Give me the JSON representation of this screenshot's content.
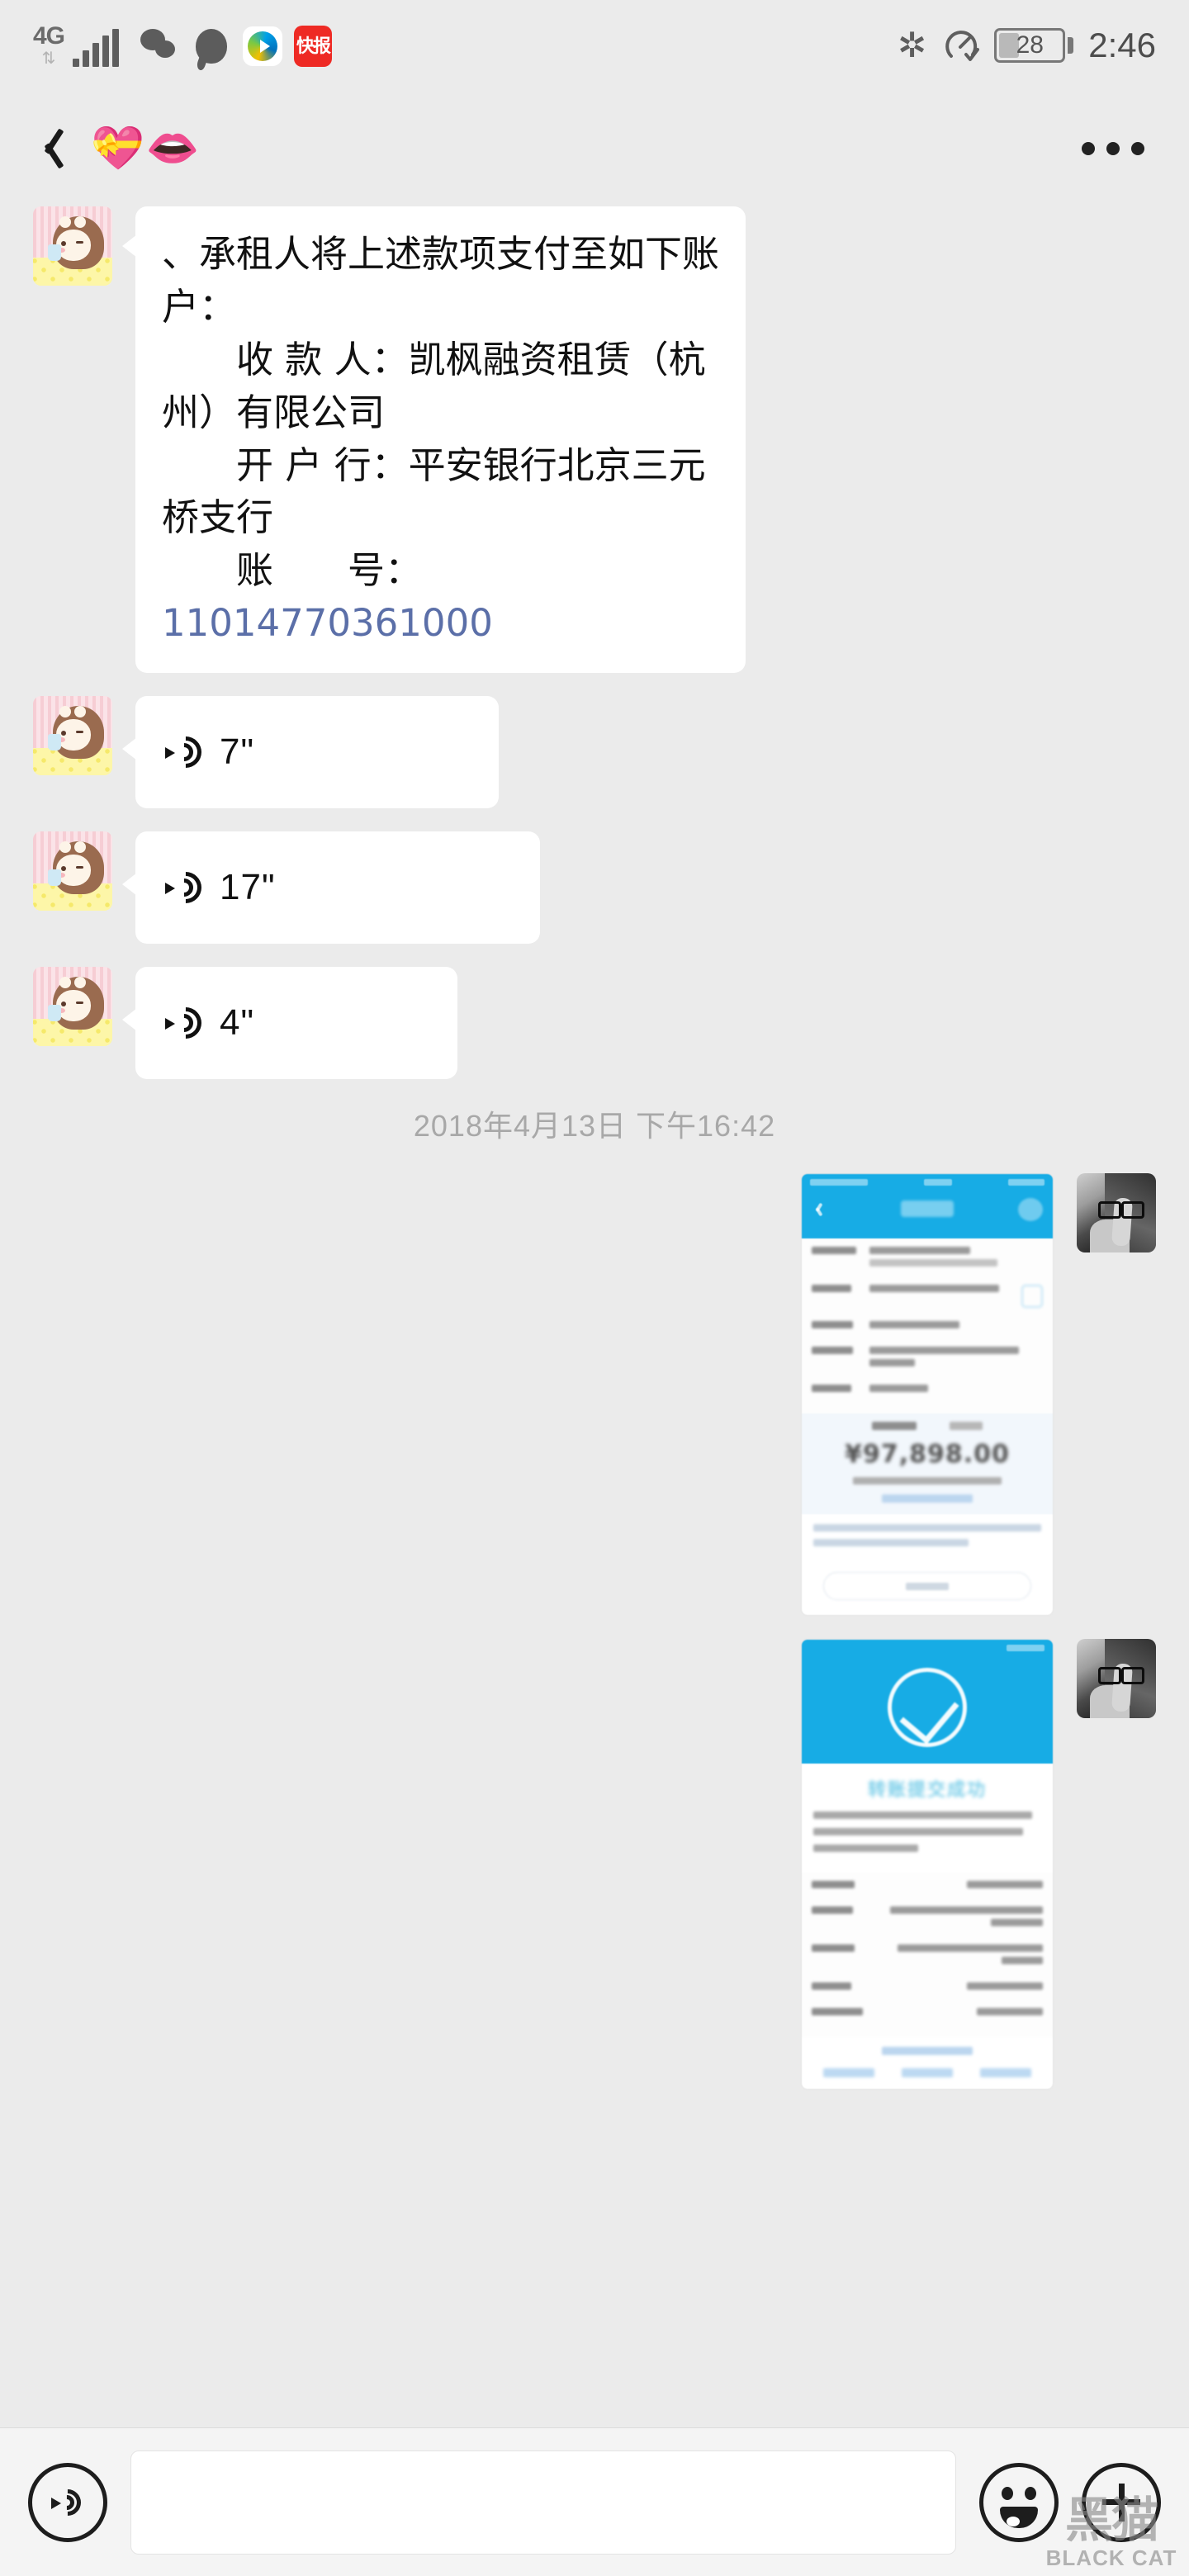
{
  "status_bar": {
    "network_type": "4G",
    "signal_icon": "signal-bars-icon",
    "app_icons": [
      "wechat-icon",
      "qq-icon",
      "tencent-video-icon",
      "kuaibao-icon"
    ],
    "kuaibao_label": "快报",
    "bluetooth_icon": "bluetooth-icon",
    "speed_icon": "speedometer-icon",
    "battery_percent": "28",
    "time": "2:46"
  },
  "navbar": {
    "back_icon": "back-chevron-icon",
    "title": "💝👄",
    "more_icon": "more-options-icon"
  },
  "messages": [
    {
      "type": "text",
      "side": "left",
      "avatar": "contact-avatar-cartoon-girl",
      "text_lines": [
        "、承租人将上述款项支付至如下账",
        "户：",
        "　　收 款 人：凯枫融资租赁（杭",
        "州）有限公司",
        "　　开 户 行：平安银行北京三元",
        "桥支行",
        "　　账　　号："
      ],
      "account_number": "11014770361000"
    },
    {
      "type": "voice",
      "side": "left",
      "avatar": "contact-avatar-cartoon-girl",
      "duration": "7\"",
      "icon": "voice-wave-icon"
    },
    {
      "type": "voice",
      "side": "left",
      "avatar": "contact-avatar-cartoon-girl",
      "duration": "17\"",
      "icon": "voice-wave-icon"
    },
    {
      "type": "voice",
      "side": "left",
      "avatar": "contact-avatar-cartoon-girl",
      "duration": "4\"",
      "icon": "voice-wave-icon"
    }
  ],
  "time_divider": "2018年4月13日 下午16:42",
  "image_messages": [
    {
      "side": "right",
      "avatar": "self-avatar-bw-photo",
      "kind": "bank-transfer-confirm-screenshot",
      "header_color": "#17ace5",
      "amount": "¥97,898.00"
    },
    {
      "side": "right",
      "avatar": "self-avatar-bw-photo",
      "kind": "transfer-success-screenshot",
      "header_color": "#17ace5",
      "success_title": "转账提交成功",
      "check_icon": "success-check-icon"
    }
  ],
  "input_bar": {
    "voice_icon": "voice-input-icon",
    "input_value": "",
    "input_placeholder": "",
    "emoji_icon": "emoji-icon",
    "plus_icon": "plus-icon"
  },
  "watermark": {
    "cn": "黑猫",
    "en": "BLACK CAT"
  },
  "colors": {
    "page_bg": "#ebebeb",
    "bubble_bg": "#ffffff",
    "link_blue": "#5b6fa8",
    "accent_blue": "#17ace5"
  }
}
